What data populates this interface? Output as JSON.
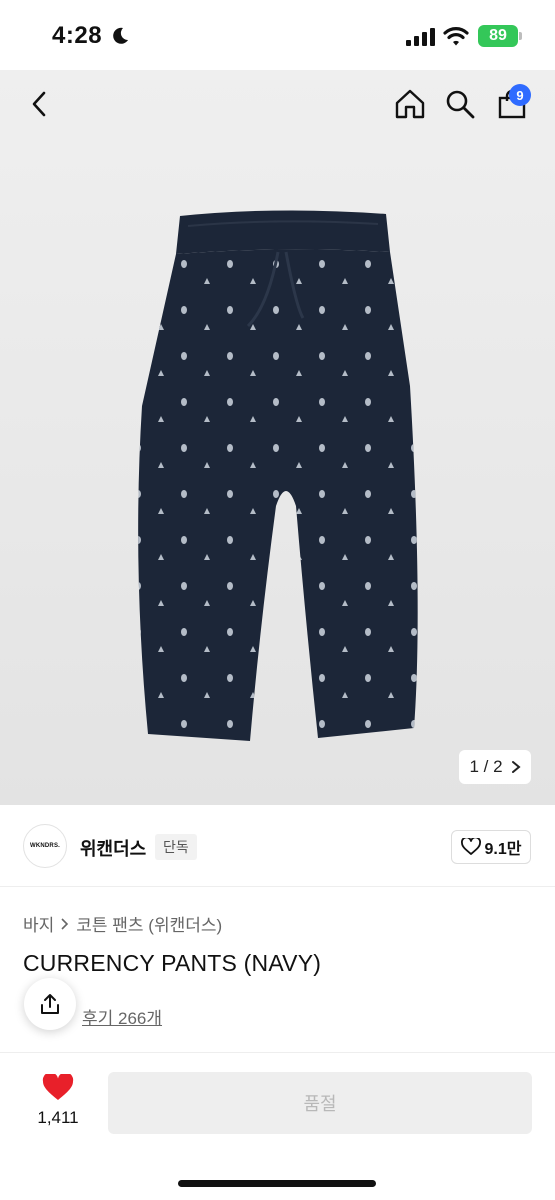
{
  "status": {
    "time": "4:28",
    "battery": "89"
  },
  "nav": {
    "cart_count": "9"
  },
  "gallery": {
    "pager": "1 / 2"
  },
  "brand": {
    "logo_text": "WKNDRS.",
    "name": "위캔더스",
    "tag": "단독",
    "likes": "9.1만"
  },
  "breadcrumb": {
    "category": "바지",
    "subcategory": "코튼 팬츠 (위캔더스)"
  },
  "product": {
    "title": "CURRENCY PANTS (NAVY)",
    "reviews": "후기 266개"
  },
  "bottom": {
    "wish_count": "1,411",
    "buy_label": "품절"
  },
  "colors": {
    "accent_badge": "#2f6bff",
    "heart": "#e8202a",
    "battery": "#34c759",
    "pants": "#1c2638"
  },
  "icons": [
    "moon-icon",
    "signal-icon",
    "wifi-icon",
    "back-icon",
    "home-icon",
    "search-icon",
    "shopping-bag-icon",
    "chevron-right-icon",
    "heart-outline-icon",
    "share-icon",
    "heart-filled-icon"
  ]
}
